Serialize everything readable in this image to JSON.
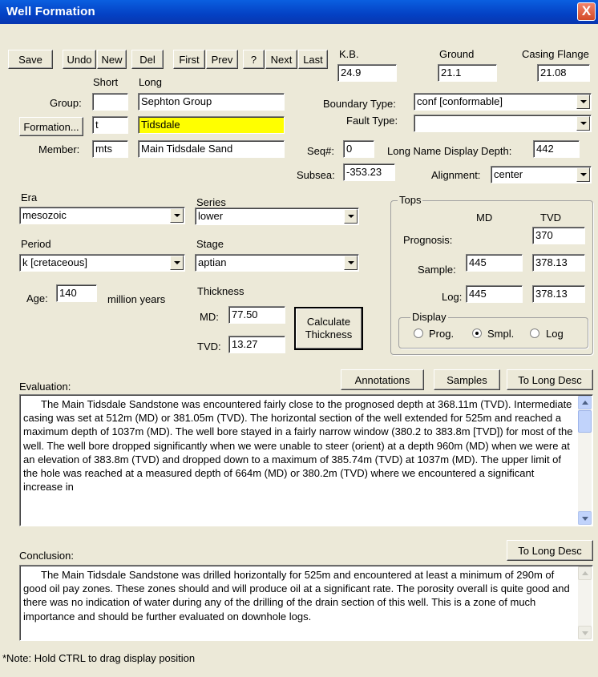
{
  "window": {
    "title": "Well Formation",
    "close": "X"
  },
  "toolbar": {
    "save": "Save",
    "undo": "Undo",
    "new": "New",
    "del": "Del",
    "first": "First",
    "prev": "Prev",
    "help": "?",
    "next": "Next",
    "last": "Last"
  },
  "elevations": {
    "kb_label": "K.B.",
    "kb_value": "24.9",
    "ground_label": "Ground",
    "ground_value": "21.1",
    "casing_label": "Casing Flange",
    "casing_value": "21.08"
  },
  "names": {
    "short_header": "Short",
    "long_header": "Long",
    "group_label": "Group:",
    "group_short": "",
    "group_long": "Sephton Group",
    "formation_button": "Formation...",
    "formation_short": "t",
    "formation_long": "Tidsdale",
    "member_label": "Member:",
    "member_short": "mts",
    "member_long": "Main Tidsdale Sand"
  },
  "boundary": {
    "boundary_type_label": "Boundary Type:",
    "boundary_type_value": "conf  [conformable]",
    "fault_type_label": "Fault Type:",
    "fault_type_value": "",
    "seq_label": "Seq#:",
    "seq_value": "0",
    "long_name_depth_label": "Long Name Display Depth:",
    "long_name_depth_value": "442",
    "subsea_label": "Subsea:",
    "subsea_value": "-353.23",
    "alignment_label": "Alignment:",
    "alignment_value": "center"
  },
  "chrono": {
    "era_label": "Era",
    "era_value": "mesozoic",
    "series_label": "Series",
    "series_value": "lower",
    "period_label": "Period",
    "period_value": "k  [cretaceous]",
    "stage_label": "Stage",
    "stage_value": "aptian",
    "age_label": "Age:",
    "age_value": "140",
    "age_unit": "million years"
  },
  "thickness": {
    "title": "Thickness",
    "md_label": "MD:",
    "md_value": "77.50",
    "tvd_label": "TVD:",
    "tvd_value": "13.27",
    "calc_button": "Calculate Thickness"
  },
  "tops": {
    "title": "Tops",
    "md_header": "MD",
    "tvd_header": "TVD",
    "prognosis_label": "Prognosis:",
    "prognosis_md": "",
    "prognosis_tvd": "370",
    "sample_label": "Sample:",
    "sample_md": "445",
    "sample_tvd": "378.13",
    "log_label": "Log:",
    "log_md": "445",
    "log_tvd": "378.13",
    "display_title": "Display",
    "display_options": [
      "Prog.",
      "Smpl.",
      "Log"
    ],
    "display_selected": "Smpl."
  },
  "evaluation": {
    "label": "Evaluation:",
    "annotations_button": "Annotations",
    "samples_button": "Samples",
    "to_long_desc_button": "To Long Desc",
    "text": "The Main Tidsdale Sandstone was encountered fairly close to the prognosed depth at 368.11m (TVD). Intermediate casing was set at 512m (MD) or 381.05m (TVD). The horizontal section of the well extended for 525m and reached a maximum depth of 1037m (MD). The well bore stayed in a fairly narrow window (380.2 to 383.8m [TVD]) for most of the well. The well bore dropped significantly when we were unable to steer (orient) at a depth 960m (MD) when we were at an elevation of 383.8m (TVD) and dropped down to a maximum of 385.74m (TVD) at 1037m (MD). The upper limit of the hole was reached at a measured depth of 664m (MD) or 380.2m (TVD) where we encountered a significant increase in"
  },
  "conclusion": {
    "label": "Conclusion:",
    "to_long_desc_button": "To Long Desc",
    "text": "The Main Tidsdale Sandstone was drilled horizontally for 525m and encountered at least a minimum of 290m of good oil pay zones. These zones should and will produce oil at a significant rate. The porosity overall is quite good and there was no indication of water during any of the drilling of the drain section of this well. This is a zone of much importance and should be further evaluated on downhole logs."
  },
  "footer": {
    "note": "*Note: Hold CTRL to drag display position"
  }
}
